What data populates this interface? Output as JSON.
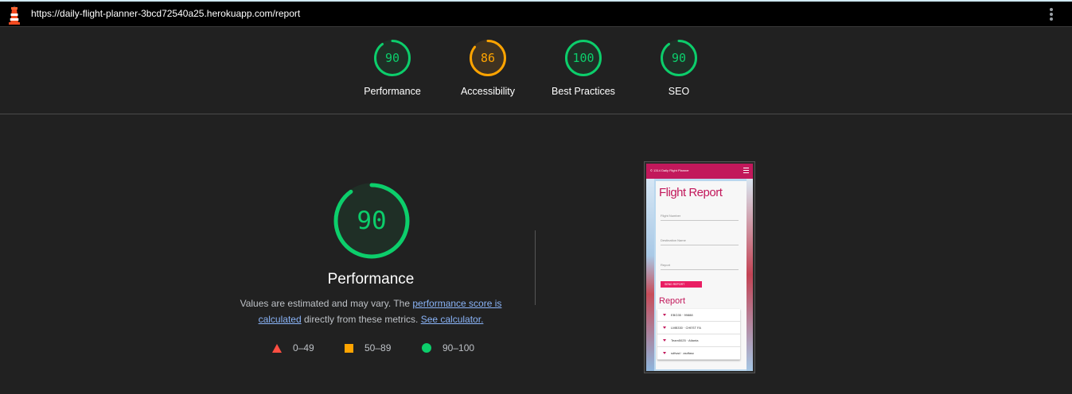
{
  "browser": {
    "url": "https://daily-flight-planner-3bcd72540a25.herokuapp.com/report",
    "logo_icon": "lighthouse-icon",
    "menu_icon": "kebab-menu-icon"
  },
  "summary_gauges": [
    {
      "score": "90",
      "label": "Performance",
      "value": 90,
      "color": "#0cce6b"
    },
    {
      "score": "86",
      "label": "Accessibility",
      "value": 86,
      "color": "#ffa400"
    },
    {
      "score": "100",
      "label": "Best Practices",
      "value": 100,
      "color": "#0cce6b"
    },
    {
      "score": "90",
      "label": "SEO",
      "value": 90,
      "color": "#0cce6b"
    }
  ],
  "performance": {
    "score": "90",
    "value": 90,
    "title": "Performance",
    "desc_prefix": "Values are estimated and may vary. The ",
    "link1": "performance score is calculated",
    "desc_middle": " directly from these metrics. ",
    "link2": "See calculator."
  },
  "legend": [
    {
      "range": "0–49",
      "shape": "triangle",
      "color": "#ff4e42"
    },
    {
      "range": "50–89",
      "shape": "square",
      "color": "#ffa400"
    },
    {
      "range": "90–100",
      "shape": "circle",
      "color": "#0cce6b"
    }
  ],
  "screenshot": {
    "app_title": "© 1314 Daily Flight Planner",
    "heading": "Flight Report",
    "fields": [
      "Flight Number",
      "Destination Name",
      "Report"
    ],
    "button": "SEND REPORT",
    "report_heading": "Report",
    "rows": [
      "EBG35 · 99888",
      "LMB330 · CHEST FA",
      "Team5025 · Atlanta",
      "sdfsad · asdfasc"
    ]
  }
}
